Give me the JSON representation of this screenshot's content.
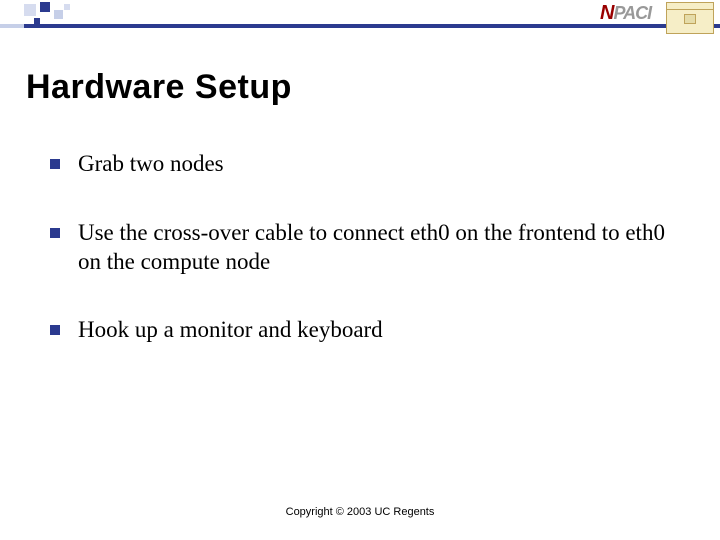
{
  "header": {
    "logo_npaci_text": "NPACI",
    "logo_sdsc_name": "sdsc-logo"
  },
  "title": "Hardware Setup",
  "bullets": [
    "Grab two nodes",
    "Use the cross-over cable to connect eth0 on the frontend to eth0 on the compute node",
    "Hook up a monitor and keyboard"
  ],
  "footer": "Copyright © 2003 UC Regents"
}
